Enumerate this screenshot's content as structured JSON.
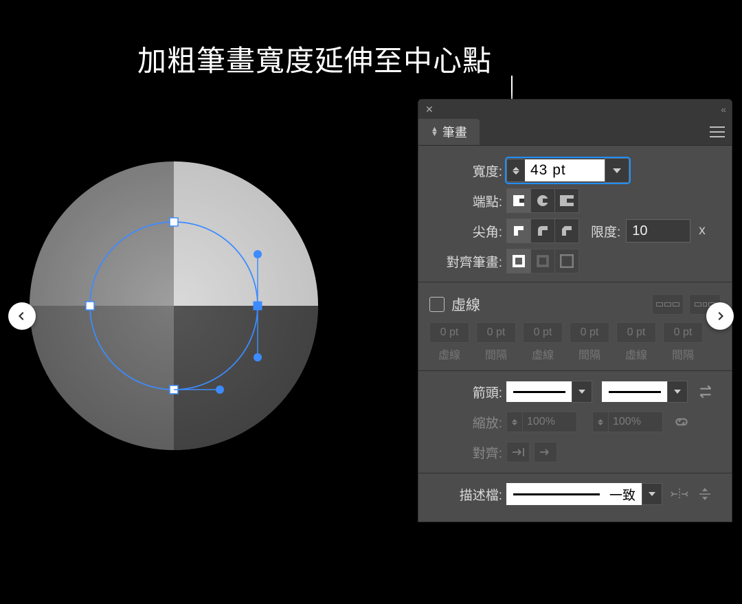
{
  "title": "加粗筆畫寬度延伸至中心點",
  "panel": {
    "tab": "筆畫",
    "labels": {
      "width": "寬度:",
      "cap": "端點:",
      "corner": "尖角:",
      "limit": "限度:",
      "align": "對齊筆畫:",
      "dashed": "虛線",
      "arrow": "箭頭:",
      "scale": "縮放:",
      "alignArrow": "對齊:",
      "profile": "描述檔:"
    },
    "width_value": "43 pt",
    "limit_value": "10",
    "limit_suffix": "x",
    "dash_cells": [
      {
        "v": "0 pt",
        "t": "虛線"
      },
      {
        "v": "0 pt",
        "t": "間隔"
      },
      {
        "v": "0 pt",
        "t": "虛線"
      },
      {
        "v": "0 pt",
        "t": "間隔"
      },
      {
        "v": "0 pt",
        "t": "虛線"
      },
      {
        "v": "0 pt",
        "t": "間隔"
      }
    ],
    "scale_value": "100%",
    "profile_value": "一致"
  },
  "colors": {
    "highlight": "#1e90ff"
  }
}
